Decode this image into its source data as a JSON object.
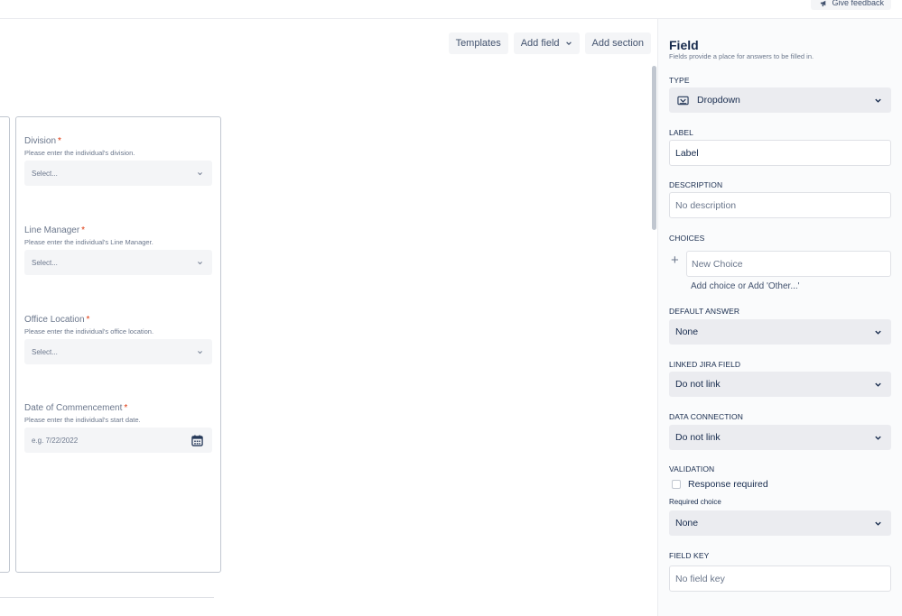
{
  "topbar": {
    "feedback_label": "Give feedback"
  },
  "toolbar": {
    "templates_label": "Templates",
    "add_field_label": "Add field",
    "add_section_label": "Add section"
  },
  "form": {
    "questions": [
      {
        "label": "Division",
        "required": "*",
        "description": "Please enter the individual's division.",
        "placeholder": "Select..."
      },
      {
        "label": "Line Manager",
        "required": "*",
        "description": "Please enter the individual's Line Manager.",
        "placeholder": "Select..."
      },
      {
        "label": "Office Location",
        "required": "*",
        "description": "Please enter the individual's office location.",
        "placeholder": "Select..."
      },
      {
        "label": "Date of Commencement",
        "required": "*",
        "description": "Please enter the individual's start date.",
        "placeholder": "e.g. 7/22/2022"
      }
    ]
  },
  "panel": {
    "title": "Field",
    "subtitle": "Fields provide a place for answers to be filled in.",
    "type_heading": "TYPE",
    "type_value": "Dropdown",
    "label_heading": "LABEL",
    "label_value": "Label",
    "description_heading": "DESCRIPTION",
    "description_placeholder": "No description",
    "choices_heading": "CHOICES",
    "new_choice_placeholder": "New Choice",
    "add_choice_text": "Add choice or Add 'Other...'",
    "default_answer_heading": "DEFAULT ANSWER",
    "default_answer_value": "None",
    "linked_jira_heading": "LINKED JIRA FIELD",
    "linked_jira_value": "Do not link",
    "data_connection_heading": "DATA CONNECTION",
    "data_connection_value": "Do not link",
    "validation_heading": "VALIDATION",
    "response_required_label": "Response required",
    "required_choice_label": "Required choice",
    "required_choice_value": "None",
    "field_key_heading": "FIELD KEY",
    "field_key_placeholder": "No field key"
  },
  "colors": {
    "required": "#de350b",
    "text": "#172b4d",
    "muted": "#6b778c",
    "field_bg": "#f4f5f7",
    "panel_bg": "#fafbfc"
  },
  "icons": [
    "megaphone-icon",
    "chevron-down-icon",
    "calendar-icon",
    "dropdown-type-icon",
    "plus-icon"
  ]
}
